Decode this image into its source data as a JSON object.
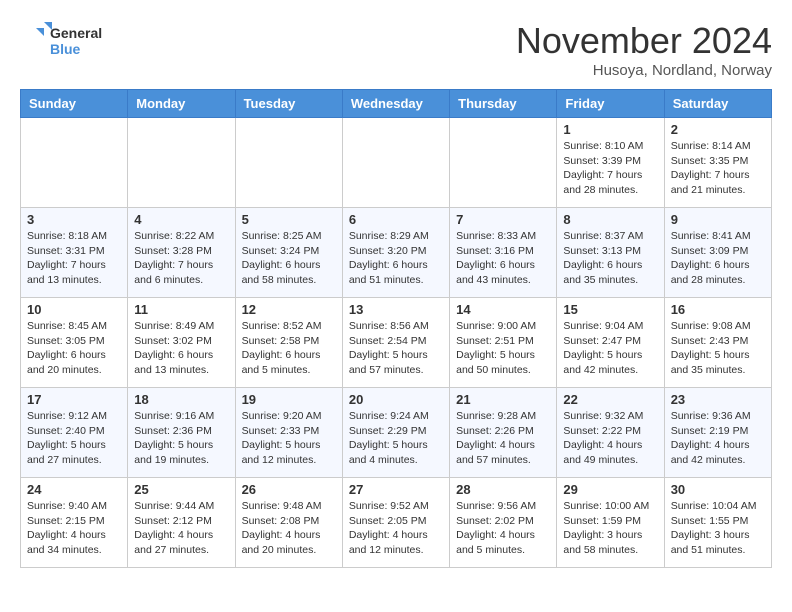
{
  "logo": {
    "line1": "General",
    "line2": "Blue"
  },
  "title": "November 2024",
  "location": "Husoya, Nordland, Norway",
  "days_of_week": [
    "Sunday",
    "Monday",
    "Tuesday",
    "Wednesday",
    "Thursday",
    "Friday",
    "Saturday"
  ],
  "weeks": [
    [
      {
        "day": "",
        "info": ""
      },
      {
        "day": "",
        "info": ""
      },
      {
        "day": "",
        "info": ""
      },
      {
        "day": "",
        "info": ""
      },
      {
        "day": "",
        "info": ""
      },
      {
        "day": "1",
        "info": "Sunrise: 8:10 AM\nSunset: 3:39 PM\nDaylight: 7 hours\nand 28 minutes."
      },
      {
        "day": "2",
        "info": "Sunrise: 8:14 AM\nSunset: 3:35 PM\nDaylight: 7 hours\nand 21 minutes."
      }
    ],
    [
      {
        "day": "3",
        "info": "Sunrise: 8:18 AM\nSunset: 3:31 PM\nDaylight: 7 hours\nand 13 minutes."
      },
      {
        "day": "4",
        "info": "Sunrise: 8:22 AM\nSunset: 3:28 PM\nDaylight: 7 hours\nand 6 minutes."
      },
      {
        "day": "5",
        "info": "Sunrise: 8:25 AM\nSunset: 3:24 PM\nDaylight: 6 hours\nand 58 minutes."
      },
      {
        "day": "6",
        "info": "Sunrise: 8:29 AM\nSunset: 3:20 PM\nDaylight: 6 hours\nand 51 minutes."
      },
      {
        "day": "7",
        "info": "Sunrise: 8:33 AM\nSunset: 3:16 PM\nDaylight: 6 hours\nand 43 minutes."
      },
      {
        "day": "8",
        "info": "Sunrise: 8:37 AM\nSunset: 3:13 PM\nDaylight: 6 hours\nand 35 minutes."
      },
      {
        "day": "9",
        "info": "Sunrise: 8:41 AM\nSunset: 3:09 PM\nDaylight: 6 hours\nand 28 minutes."
      }
    ],
    [
      {
        "day": "10",
        "info": "Sunrise: 8:45 AM\nSunset: 3:05 PM\nDaylight: 6 hours\nand 20 minutes."
      },
      {
        "day": "11",
        "info": "Sunrise: 8:49 AM\nSunset: 3:02 PM\nDaylight: 6 hours\nand 13 minutes."
      },
      {
        "day": "12",
        "info": "Sunrise: 8:52 AM\nSunset: 2:58 PM\nDaylight: 6 hours\nand 5 minutes."
      },
      {
        "day": "13",
        "info": "Sunrise: 8:56 AM\nSunset: 2:54 PM\nDaylight: 5 hours\nand 57 minutes."
      },
      {
        "day": "14",
        "info": "Sunrise: 9:00 AM\nSunset: 2:51 PM\nDaylight: 5 hours\nand 50 minutes."
      },
      {
        "day": "15",
        "info": "Sunrise: 9:04 AM\nSunset: 2:47 PM\nDaylight: 5 hours\nand 42 minutes."
      },
      {
        "day": "16",
        "info": "Sunrise: 9:08 AM\nSunset: 2:43 PM\nDaylight: 5 hours\nand 35 minutes."
      }
    ],
    [
      {
        "day": "17",
        "info": "Sunrise: 9:12 AM\nSunset: 2:40 PM\nDaylight: 5 hours\nand 27 minutes."
      },
      {
        "day": "18",
        "info": "Sunrise: 9:16 AM\nSunset: 2:36 PM\nDaylight: 5 hours\nand 19 minutes."
      },
      {
        "day": "19",
        "info": "Sunrise: 9:20 AM\nSunset: 2:33 PM\nDaylight: 5 hours\nand 12 minutes."
      },
      {
        "day": "20",
        "info": "Sunrise: 9:24 AM\nSunset: 2:29 PM\nDaylight: 5 hours\nand 4 minutes."
      },
      {
        "day": "21",
        "info": "Sunrise: 9:28 AM\nSunset: 2:26 PM\nDaylight: 4 hours\nand 57 minutes."
      },
      {
        "day": "22",
        "info": "Sunrise: 9:32 AM\nSunset: 2:22 PM\nDaylight: 4 hours\nand 49 minutes."
      },
      {
        "day": "23",
        "info": "Sunrise: 9:36 AM\nSunset: 2:19 PM\nDaylight: 4 hours\nand 42 minutes."
      }
    ],
    [
      {
        "day": "24",
        "info": "Sunrise: 9:40 AM\nSunset: 2:15 PM\nDaylight: 4 hours\nand 34 minutes."
      },
      {
        "day": "25",
        "info": "Sunrise: 9:44 AM\nSunset: 2:12 PM\nDaylight: 4 hours\nand 27 minutes."
      },
      {
        "day": "26",
        "info": "Sunrise: 9:48 AM\nSunset: 2:08 PM\nDaylight: 4 hours\nand 20 minutes."
      },
      {
        "day": "27",
        "info": "Sunrise: 9:52 AM\nSunset: 2:05 PM\nDaylight: 4 hours\nand 12 minutes."
      },
      {
        "day": "28",
        "info": "Sunrise: 9:56 AM\nSunset: 2:02 PM\nDaylight: 4 hours\nand 5 minutes."
      },
      {
        "day": "29",
        "info": "Sunrise: 10:00 AM\nSunset: 1:59 PM\nDaylight: 3 hours\nand 58 minutes."
      },
      {
        "day": "30",
        "info": "Sunrise: 10:04 AM\nSunset: 1:55 PM\nDaylight: 3 hours\nand 51 minutes."
      }
    ]
  ]
}
